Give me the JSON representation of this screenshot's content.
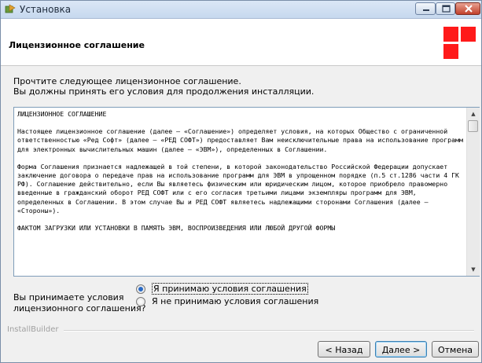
{
  "window": {
    "title": "Установка",
    "accent_color": "#ff1a1a"
  },
  "header": {
    "title": "Лицензионное соглашение"
  },
  "instructions": {
    "line1": "Прочтите следующее лицензионное соглашение.",
    "line2": "Вы должны принять его условия для продолжения инсталляции."
  },
  "license": {
    "heading": "ЛИЦЕНЗИОННОЕ СОГЛАШЕНИЕ",
    "p1": "Настоящее лицензионное соглашение (далее – «Соглашение») определяет условия, на которых Общество с ограниченной ответственностью «Ред Софт» (далее – «РЕД СОФТ») предоставляет Вам неисключительные права на использование программ для электронных вычислительных машин (далее – «ЭВМ»), определенных в Соглашении.",
    "p2": "Форма Соглашения признается надлежащей в той степени, в которой законодательство Российской Федерации допускает заключение договора о передаче прав на использование программ для ЭВМ в упрощенном порядке (п.5 ст.1286 части 4 ГК РФ). Соглашение действительно, если Вы являетесь физическим или юридическим лицом, которое приобрело правомерно введенные в гражданский оборот РЕД СОФТ или с его согласия третьими лицами экземпляры программ для ЭВМ, определенных в Соглашении. В этом случае Вы и РЕД СОФТ являетесь надлежащими сторонами Соглашения (далее – «Стороны»).",
    "p3": "ФАКТОМ ЗАГРУЗКИ ИЛИ УСТАНОВКИ В ПАМЯТЬ ЭВМ, ВОСПРОИЗВЕДЕНИЯ ИЛИ ЛЮБОЙ ДРУГОЙ ФОРМЫ"
  },
  "accept": {
    "question_line1": "Вы принимаете условия",
    "question_line2": "лицензионного соглашения?",
    "option_accept": "Я принимаю условия соглашения",
    "option_decline": "Я не принимаю условия соглашения",
    "selected": "accept"
  },
  "footer": {
    "brand": "InstallBuilder",
    "back_label": "< Назад",
    "next_label": "Далее >",
    "cancel_label": "Отмена"
  }
}
